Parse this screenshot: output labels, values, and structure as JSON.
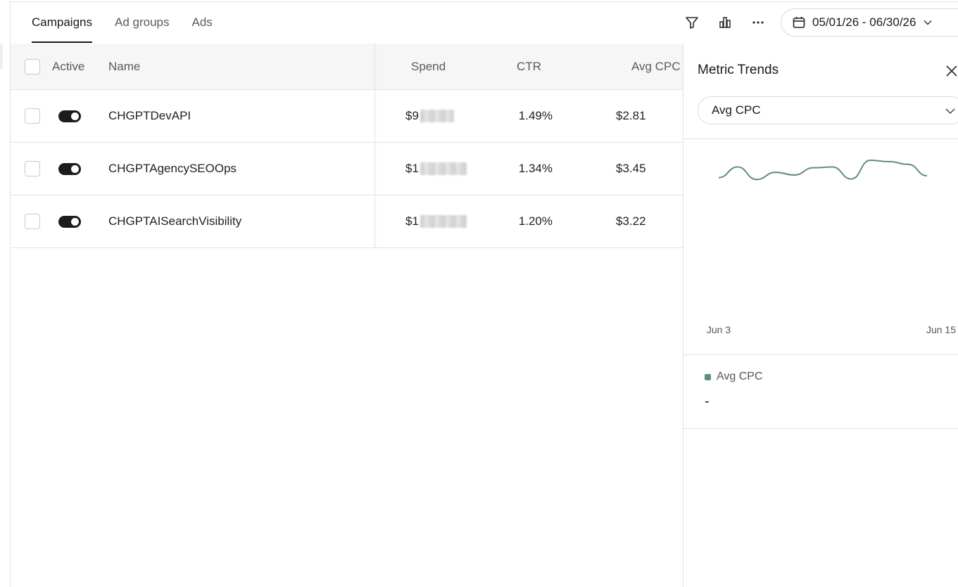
{
  "tabs": [
    {
      "label": "Campaigns",
      "active": true
    },
    {
      "label": "Ad groups",
      "active": false
    },
    {
      "label": "Ads",
      "active": false
    }
  ],
  "toolbar": {
    "icons": [
      "filter-icon",
      "bar-chart-icon",
      "more-icon"
    ],
    "date_range": "05/01/26 - 06/30/26"
  },
  "table": {
    "columns": {
      "active": "Active",
      "name": "Name",
      "spend": "Spend",
      "ctr": "CTR",
      "avg_cpc": "Avg CPC"
    },
    "rows": [
      {
        "active": true,
        "name": "CHGPTDevAPI",
        "spend_prefix": "$9",
        "ctr": "1.49%",
        "avg_cpc": "$2.81"
      },
      {
        "active": true,
        "name": "CHGPTAgencySEOOps",
        "spend_prefix": "$1",
        "ctr": "1.34%",
        "avg_cpc": "$3.45"
      },
      {
        "active": true,
        "name": "CHGPTAISearchVisibility",
        "spend_prefix": "$1",
        "ctr": "1.20%",
        "avg_cpc": "$3.22"
      }
    ]
  },
  "panel": {
    "title": "Metric Trends",
    "metric_selected": "Avg CPC",
    "legend_label": "Avg CPC",
    "legend_value": "-",
    "legend_color": "#5e8f78"
  },
  "chart_data": {
    "type": "line",
    "title": "",
    "xlabel": "",
    "ylabel": "",
    "x_ticks": [
      "Jun 3",
      "Jun 15"
    ],
    "series": [
      {
        "name": "Avg CPC",
        "color": "#5e8f78",
        "values": [
          0.35,
          0.75,
          0.28,
          0.55,
          0.45,
          0.72,
          0.75,
          0.3,
          1.0,
          0.95,
          0.85,
          0.42
        ]
      }
    ],
    "grid": false
  }
}
